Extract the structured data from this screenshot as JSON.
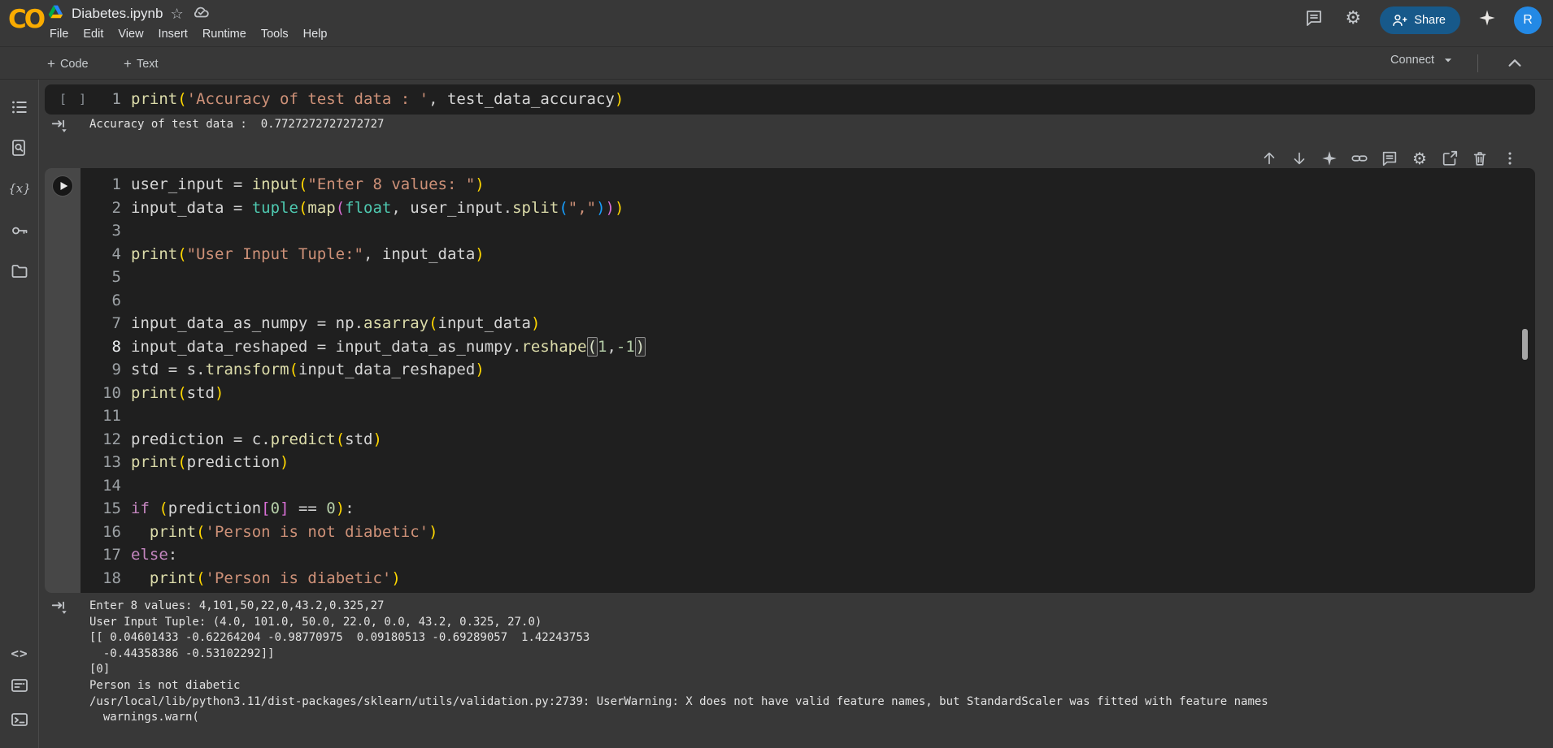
{
  "colors": {
    "page_bg": "#383838",
    "editor_bg": "#1f1f1f",
    "gutter_band": "#474747",
    "logo_orange": "#F9AB00",
    "share_blue": "#17598a",
    "avatar_blue": "#2389e5",
    "string": "#ce9178",
    "function": "#dcdcaa",
    "keyword": "#c586c0",
    "number": "#b5cea8",
    "type": "#4ec9b0",
    "bracket1": "#ffd700",
    "bracket2": "#da70d6",
    "bracket3": "#179fff"
  },
  "header": {
    "logo_text": "CO",
    "filename": "Diabetes.ipynb",
    "menus": [
      "File",
      "Edit",
      "View",
      "Insert",
      "Runtime",
      "Tools",
      "Help"
    ],
    "share_label": "Share",
    "avatar_initial": "R"
  },
  "toolbar": {
    "add_code_label": "Code",
    "add_text_label": "Text",
    "plus": "+",
    "connect_label": "Connect"
  },
  "sidebar_icons": [
    "table-of-contents",
    "find-and-replace",
    "variables",
    "secrets",
    "files",
    "code-snippets",
    "command-palette",
    "terminal"
  ],
  "cell_toolbar_icons": [
    "move-cell-up",
    "move-cell-down",
    "ask-gemini",
    "copy-cell-link",
    "add-comment",
    "editor-settings",
    "mirror-cell-in-tab",
    "delete-cell",
    "more-cell-actions"
  ],
  "cells": [
    {
      "exec_indicator": "[ ]",
      "lines": [
        {
          "num": "1",
          "tokens": [
            [
              "f",
              "print"
            ],
            [
              "b1",
              "("
            ],
            [
              "s",
              "'Accuracy of test data : '"
            ],
            [
              "o",
              ", "
            ],
            [
              "v",
              "test_data_accuracy"
            ],
            [
              "b1",
              ")"
            ]
          ]
        }
      ],
      "output_lines": [
        "Accuracy of test data :  0.7727272727272727"
      ]
    },
    {
      "focused": true,
      "lines": [
        {
          "num": "1",
          "tokens": [
            [
              "v",
              "user_input "
            ],
            [
              "o",
              "= "
            ],
            [
              "f",
              "input"
            ],
            [
              "b1",
              "("
            ],
            [
              "s",
              "\"Enter 8 values: \""
            ],
            [
              "b1",
              ")"
            ]
          ]
        },
        {
          "num": "2",
          "tokens": [
            [
              "v",
              "input_data "
            ],
            [
              "o",
              "= "
            ],
            [
              "t",
              "tuple"
            ],
            [
              "b1",
              "("
            ],
            [
              "f",
              "map"
            ],
            [
              "b2",
              "("
            ],
            [
              "t",
              "float"
            ],
            [
              "o",
              ", "
            ],
            [
              "v",
              "user_input"
            ],
            [
              "o",
              "."
            ],
            [
              "f",
              "split"
            ],
            [
              "b3",
              "("
            ],
            [
              "s",
              "\",\""
            ],
            [
              "b3",
              ")"
            ],
            [
              "b2",
              ")"
            ],
            [
              "b1",
              ")"
            ]
          ]
        },
        {
          "num": "3",
          "tokens": []
        },
        {
          "num": "4",
          "tokens": [
            [
              "f",
              "print"
            ],
            [
              "b1",
              "("
            ],
            [
              "s",
              "\"User Input Tuple:\""
            ],
            [
              "o",
              ", "
            ],
            [
              "v",
              "input_data"
            ],
            [
              "b1",
              ")"
            ]
          ]
        },
        {
          "num": "5",
          "tokens": []
        },
        {
          "num": "6",
          "tokens": []
        },
        {
          "num": "7",
          "tokens": [
            [
              "v",
              "input_data_as_numpy "
            ],
            [
              "o",
              "= "
            ],
            [
              "v",
              "np"
            ],
            [
              "o",
              "."
            ],
            [
              "f",
              "asarray"
            ],
            [
              "b1",
              "("
            ],
            [
              "v",
              "input_data"
            ],
            [
              "b1",
              ")"
            ]
          ]
        },
        {
          "num": "8",
          "active": true,
          "tokens": [
            [
              "v",
              "input_data_reshaped "
            ],
            [
              "o",
              "= "
            ],
            [
              "v",
              "input_data_as_numpy"
            ],
            [
              "o",
              "."
            ],
            [
              "f",
              "reshape"
            ],
            [
              "hb",
              "("
            ],
            [
              "n",
              "1"
            ],
            [
              "o",
              ","
            ],
            [
              "n",
              "-1"
            ],
            [
              "hb",
              ")"
            ]
          ]
        },
        {
          "num": "9",
          "tokens": [
            [
              "v",
              "std "
            ],
            [
              "o",
              "= "
            ],
            [
              "v",
              "s"
            ],
            [
              "o",
              "."
            ],
            [
              "f",
              "transform"
            ],
            [
              "b1",
              "("
            ],
            [
              "v",
              "input_data_reshaped"
            ],
            [
              "b1",
              ")"
            ]
          ]
        },
        {
          "num": "10",
          "tokens": [
            [
              "f",
              "print"
            ],
            [
              "b1",
              "("
            ],
            [
              "v",
              "std"
            ],
            [
              "b1",
              ")"
            ]
          ]
        },
        {
          "num": "11",
          "tokens": []
        },
        {
          "num": "12",
          "tokens": [
            [
              "v",
              "prediction "
            ],
            [
              "o",
              "= "
            ],
            [
              "v",
              "c"
            ],
            [
              "o",
              "."
            ],
            [
              "f",
              "predict"
            ],
            [
              "b1",
              "("
            ],
            [
              "v",
              "std"
            ],
            [
              "b1",
              ")"
            ]
          ]
        },
        {
          "num": "13",
          "tokens": [
            [
              "f",
              "print"
            ],
            [
              "b1",
              "("
            ],
            [
              "v",
              "prediction"
            ],
            [
              "b1",
              ")"
            ]
          ]
        },
        {
          "num": "14",
          "tokens": []
        },
        {
          "num": "15",
          "tokens": [
            [
              "k",
              "if "
            ],
            [
              "b1",
              "("
            ],
            [
              "v",
              "prediction"
            ],
            [
              "b2",
              "["
            ],
            [
              "n",
              "0"
            ],
            [
              "b2",
              "]"
            ],
            [
              "o",
              " == "
            ],
            [
              "n",
              "0"
            ],
            [
              "b1",
              ")"
            ],
            [
              "o",
              ":"
            ]
          ]
        },
        {
          "num": "16",
          "tokens": [
            [
              "o",
              "  "
            ],
            [
              "f",
              "print"
            ],
            [
              "b1",
              "("
            ],
            [
              "s",
              "'Person is not diabetic'"
            ],
            [
              "b1",
              ")"
            ]
          ]
        },
        {
          "num": "17",
          "tokens": [
            [
              "k",
              "else"
            ],
            [
              "o",
              ":"
            ]
          ]
        },
        {
          "num": "18",
          "tokens": [
            [
              "o",
              "  "
            ],
            [
              "f",
              "print"
            ],
            [
              "b1",
              "("
            ],
            [
              "s",
              "'Person is diabetic'"
            ],
            [
              "b1",
              ")"
            ]
          ]
        }
      ],
      "output_lines": [
        "Enter 8 values: 4,101,50,22,0,43.2,0.325,27",
        "User Input Tuple: (4.0, 101.0, 50.0, 22.0, 0.0, 43.2, 0.325, 27.0)",
        "[[ 0.04601433 -0.62264204 -0.98770975  0.09180513 -0.69289057  1.42243753",
        "  -0.44358386 -0.53102292]]",
        "[0]",
        "Person is not diabetic",
        "/usr/local/lib/python3.11/dist-packages/sklearn/utils/validation.py:2739: UserWarning: X does not have valid feature names, but StandardScaler was fitted with feature names",
        "  warnings.warn("
      ]
    }
  ]
}
